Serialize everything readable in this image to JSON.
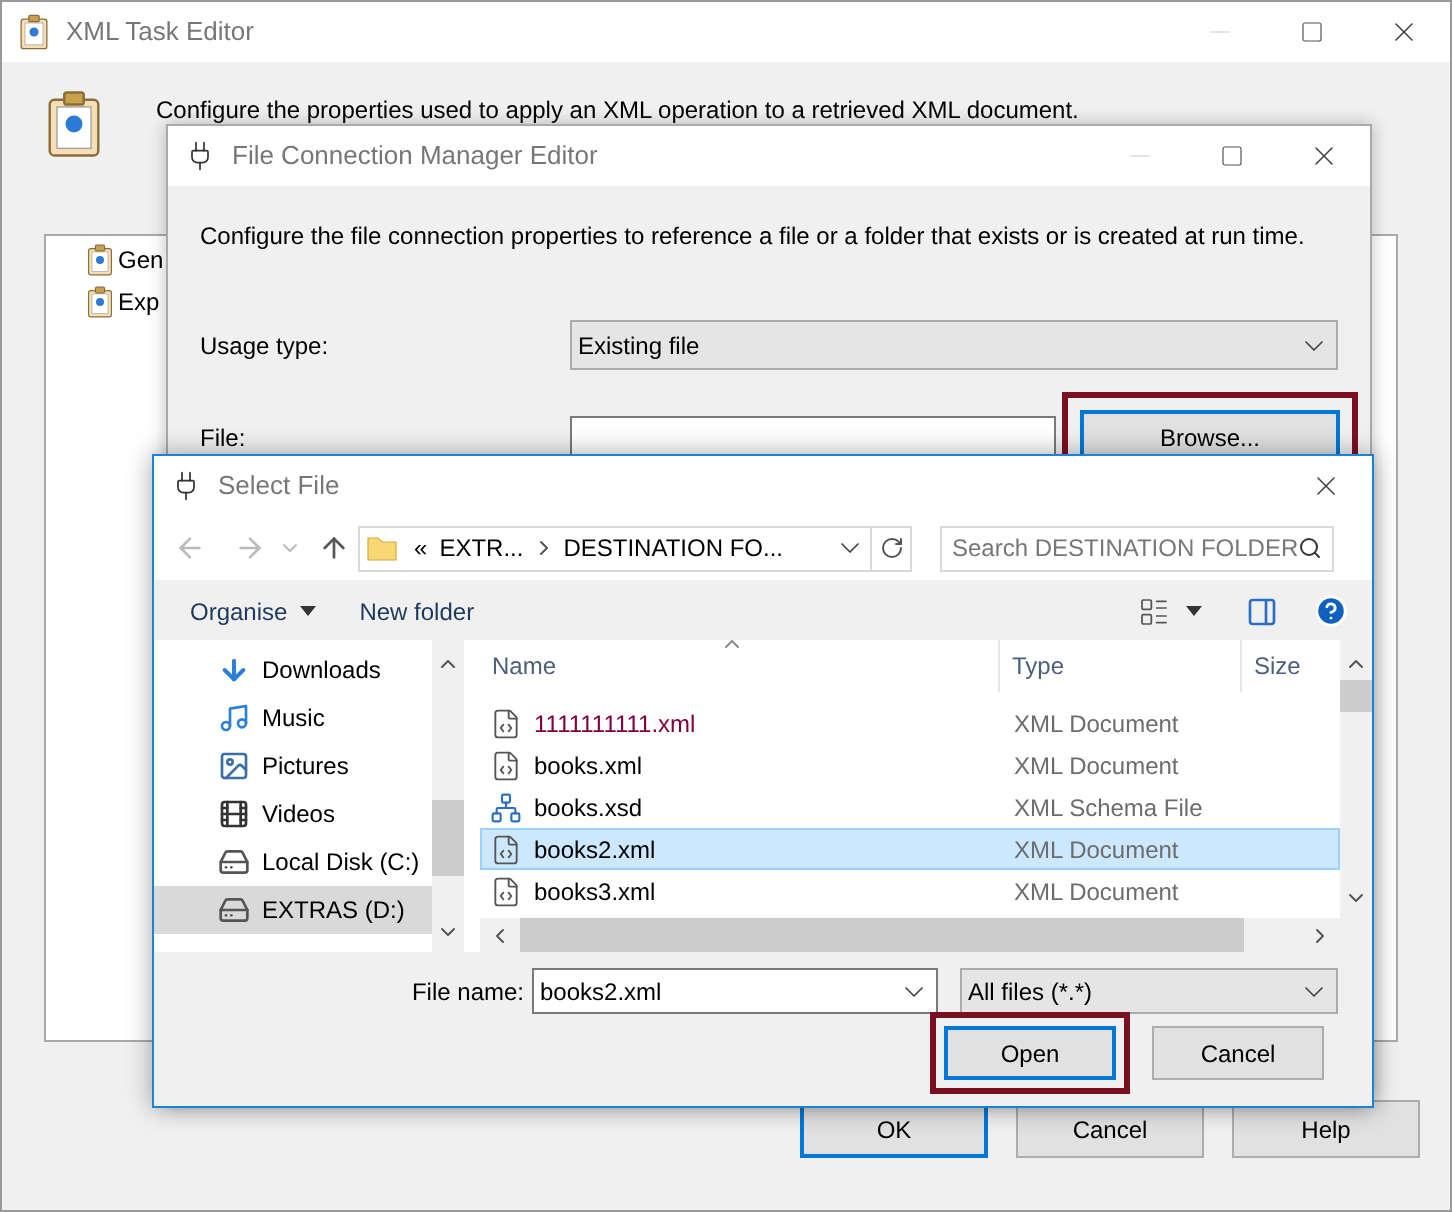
{
  "main_window": {
    "title": "XML Task Editor",
    "description": "Configure the properties used to apply an XML operation to a retrieved XML document.",
    "tree": [
      {
        "label": "Gen"
      },
      {
        "label": "Exp"
      }
    ],
    "buttons": [
      {
        "label": "OK",
        "default": true
      },
      {
        "label": "Cancel",
        "default": false
      },
      {
        "label": "Help",
        "default": false
      }
    ]
  },
  "connection_dialog": {
    "title": "File Connection Manager Editor",
    "description": "Configure the file connection properties to reference a file or a folder that exists or is created at run time.",
    "usage_type": {
      "label": "Usage type:",
      "value": "Existing file"
    },
    "file": {
      "label": "File:"
    },
    "browse_button": {
      "label": "Browse...",
      "highlighted": true
    }
  },
  "select_file": {
    "title": "Select File",
    "path": {
      "overflow": "«",
      "segments": [
        "EXTR...",
        "DESTINATION FO..."
      ]
    },
    "search": {
      "placeholder": "Search DESTINATION FOLDER"
    },
    "toolbar": [
      {
        "label": "Organise",
        "dropdown": true
      },
      {
        "label": "New folder",
        "dropdown": false
      }
    ],
    "nav_items": [
      {
        "label": "Downloads",
        "kind": "downloads",
        "selected": false
      },
      {
        "label": "Music",
        "kind": "music",
        "selected": false
      },
      {
        "label": "Pictures",
        "kind": "pictures",
        "selected": false
      },
      {
        "label": "Videos",
        "kind": "videos",
        "selected": false
      },
      {
        "label": "Local Disk (C:)",
        "kind": "drive",
        "selected": false
      },
      {
        "label": "EXTRAS (D:)",
        "kind": "drive",
        "selected": true
      }
    ],
    "columns": [
      "Name",
      "Type",
      "Size"
    ],
    "files": [
      {
        "name": "1111111111.xml",
        "type": "XML Document",
        "kind": "xml",
        "color": "#800040",
        "selected": false
      },
      {
        "name": "books.xml",
        "type": "XML Document",
        "kind": "xml",
        "color": "#000000",
        "selected": false
      },
      {
        "name": "books.xsd",
        "type": "XML Schema File",
        "kind": "xsd",
        "color": "#000000",
        "selected": false
      },
      {
        "name": "books2.xml",
        "type": "XML Document",
        "kind": "xml",
        "color": "#000000",
        "selected": true
      },
      {
        "name": "books3.xml",
        "type": "XML Document",
        "kind": "xml",
        "color": "#000000",
        "selected": false
      }
    ],
    "file_name": {
      "label": "File name:",
      "value": "books2.xml"
    },
    "filter": {
      "value": "All files (*.*)"
    },
    "buttons": [
      {
        "label": "Open",
        "default": true,
        "highlighted": true
      },
      {
        "label": "Cancel",
        "default": false,
        "highlighted": false
      }
    ]
  }
}
